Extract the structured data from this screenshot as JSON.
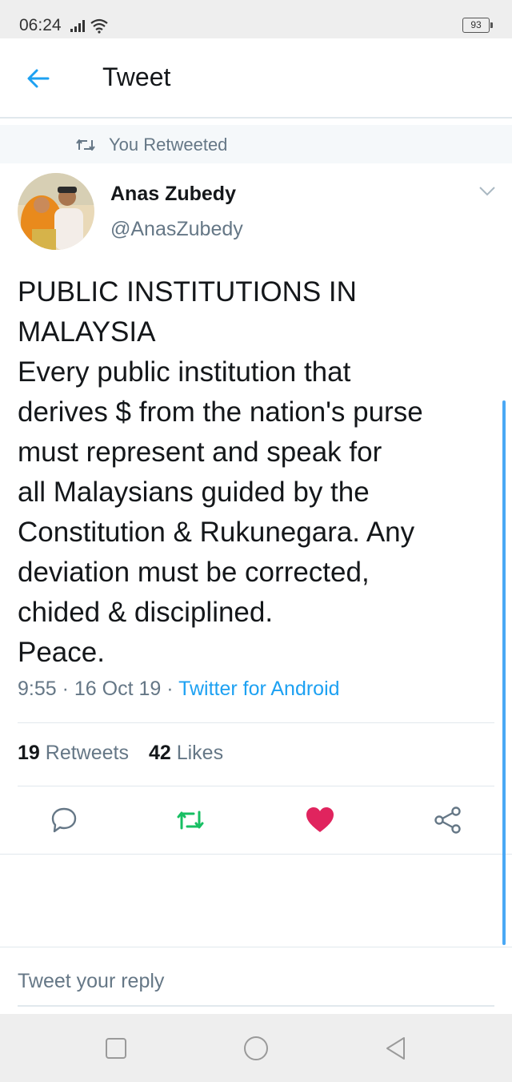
{
  "status_bar": {
    "time": "06:24",
    "battery": "93"
  },
  "header": {
    "title": "Tweet",
    "back_icon": "arrow-left-icon"
  },
  "retweet_context": {
    "label": "You Retweeted"
  },
  "author": {
    "name": "Anas Zubedy",
    "handle": "@AnasZubedy"
  },
  "tweet": {
    "text": "PUBLIC INSTITUTIONS IN\nMALAYSIA\nEvery public institution that\nderives $ from the nation's purse\nmust represent and speak for\nall Malaysians guided by the\nConstitution & Rukunegara. Any\ndeviation must be corrected,\nchided & disciplined.\nPeace.",
    "time": "9:55",
    "date": "16 Oct 19",
    "source": "Twitter for Android"
  },
  "stats": {
    "retweets_count": "19",
    "retweets_label": "Retweets",
    "likes_count": "42",
    "likes_label": "Likes"
  },
  "colors": {
    "brand_blue": "#1da1f2",
    "retweet_green": "#17bf63",
    "like_red": "#e0245e"
  },
  "reply": {
    "placeholder": "Tweet your reply"
  }
}
